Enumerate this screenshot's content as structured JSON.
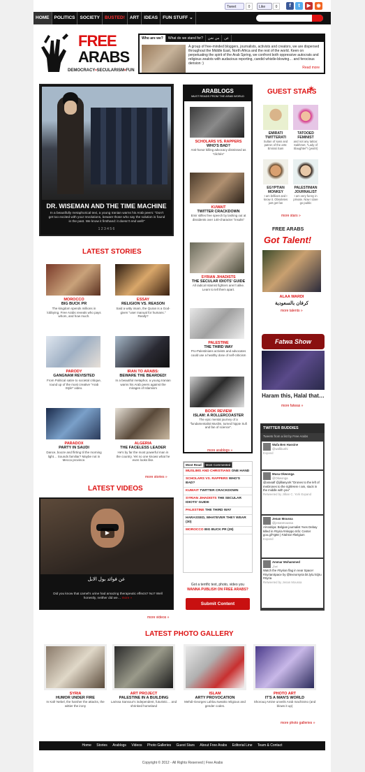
{
  "social": {
    "tweet": "Tweet",
    "like": "Like",
    "tweet_count": "0",
    "like_count": "0"
  },
  "nav": [
    "HOME",
    "POLITICS",
    "SOCIETY",
    "BUSTED!",
    "ART",
    "IDEAS",
    "FUN STUFF"
  ],
  "logo": {
    "line1": "FREE",
    "line2": "ARABS",
    "tag": [
      "DEMOCRACY",
      "SECULARISM",
      "FUN"
    ]
  },
  "who": {
    "tabs": [
      "Who are we?",
      "What do we stand for?",
      "من نحن",
      "عن"
    ],
    "text": "A group of free-minded bloggers, journalists, activists and creators, we are dispersed throughout the Middle East, North Africa and the rest of the world. Keen on perpetuating the spirit of the Arab Spring, we confront both oppressive autocrats and religious zealots with audacious reporting, candid whistle-blowing… and ferocious derision :)",
    "more": "Read more"
  },
  "hero": {
    "title": "DR. WISEMAN AND THE TIME MACHINE",
    "text": "In a beautifully metaphorical text, a young Iranian warns his Arab peers: \"Don't get too excited with your revolutions, beware those who say the solution is found in the past. We know it firsthand: it doesn't end well!\"",
    "pages": "1 2 3 4 5 6"
  },
  "latest": {
    "heading": "LATEST STORIES",
    "more": "more stories »",
    "items": [
      {
        "cat": "MOROCCO",
        "title": "BIG BUCK PR",
        "desc": "The kingdom spends millions in lobbying. Free Arabs reveals who pays whom, and how much."
      },
      {
        "cat": "ESSAY",
        "title": "RELIGION VS. REASON",
        "desc": "Said a witty imam, the Quran is a God-given \"user manual for humans.\" Really?"
      },
      {
        "cat": "PARODY",
        "title": "GANGNAM REVISITED",
        "desc": "From Political satire to societal critique, round up of the most creative \"Arab Style\" video."
      },
      {
        "cat": "IRAN TO ARABS:",
        "title": "BEWARE THE BEARDED!",
        "desc": "In a beautiful metaphor, a young Iranian warns his Arab peers against the mirages of Islamism"
      },
      {
        "cat": "PARADOX",
        "title": "PARTY IN SAUDI",
        "desc": "Dance, booze and flirting til the morning light… Sounds familiar? Maybe not in Mecca province."
      },
      {
        "cat": "ALGERIA",
        "title": "THE FACELESS LEADER",
        "desc": "He's by far the most powerful man in the country. Yet no one knows what he even looks like."
      }
    ]
  },
  "arablogs": {
    "title": "ARABLOGS",
    "sub": "MUST READS FROM THE ARAB WORLD",
    "more": "more arablogs »",
    "items": [
      {
        "t1": "SCHOLARS VS. RAPPERS",
        "t2": "WHO'S BAD?",
        "desc": "Anti-honor killing advocacy dismissed as \"clichés\""
      },
      {
        "t1": "KUWAIT",
        "t2": "TWITTER CRACKDOWN",
        "desc": "Emir stifles free speech by lashing out at dissidents over 140-character \"insults\""
      },
      {
        "t1": "SYRIAN JIHADISTS",
        "t2": "THE SECULAR IDIOTS' GUIDE",
        "desc": "All radical Islamist fighters aren't alike. Learn to tell them apart."
      },
      {
        "t1": "PALESTINE",
        "t2": "THE THIRD WAY",
        "desc": "Pro-Palestinians activists and advocates could use a healthy dose of self-criticism"
      },
      {
        "t1": "BOOK REVIEW",
        "t2": "ISLAM: A ROLLERCOASTER",
        "desc": "The epic mental journey of a \"fundamentalist Muslim, turned hippie Sufi and fan of science\"."
      }
    ]
  },
  "guests": {
    "title": "GUEST STARS",
    "more": "more stars »",
    "items": [
      {
        "name": "EMIRATI TWITTERATI",
        "desc": "Sultan of sass and patron of the arts: Emirati Sam"
      },
      {
        "name": "TATOOED FEMINIST",
        "desc": "and not any tattoo: Sakhmet, \"Lady of Slaughter\"! (yeah!)"
      },
      {
        "name": "EGYPTIAN MONKEY",
        "desc": "I am brilliant and I know it. Obsoletes just get fan"
      },
      {
        "name": "PALESTINIAN JOURNALIST",
        "desc": "I am very funny in private. Now I dare go public"
      }
    ]
  },
  "talent": {
    "title1": "FREE ARABS",
    "title2": "Got Talent!",
    "name": "ALAA WARDI",
    "arabic": "كرفان بالسعودية",
    "more": "more talents »"
  },
  "fatwa": {
    "title": "Fatwa Show",
    "caption": "Haram this, Halal that…",
    "more": "more fatwas »"
  },
  "videos": {
    "heading": "LATEST VIDEOS",
    "arabic": "عن فوائد بول الابل",
    "text": "Did you know that camel's urine had amazing therapeutic effects? No? Well honestly, neither did we…",
    "more_inline": "more »",
    "more": "more videos »"
  },
  "mostread": {
    "tabs": [
      "Most Read",
      "Most Commented"
    ],
    "items": [
      {
        "b": "MUSLIMS AND CHRISTIANS",
        "t": "ONE HAND"
      },
      {
        "b": "SCHOLARS VS. RAPPERS",
        "t": "WHO'S BAD?"
      },
      {
        "b": "KUWAIT",
        "t": "TWITTER CRACKDOWN"
      },
      {
        "b": "SYRIAN JIHADISTS",
        "t": "THE SECULAR IDIOTS' GUIDE"
      },
      {
        "b": "PALESTINE",
        "t": "THE THIRD WAY"
      },
      {
        "b": "",
        "t": "HARASSED, WHATEVER THEY WEAR (30)"
      },
      {
        "b": "MOROCCO",
        "t": "BIG BUCK PR (29)"
      }
    ]
  },
  "submit": {
    "q": "Got a terrific text, photo, video you",
    "link": "WANNA PUBLISH ON FREE ARABS?",
    "btn": "Submit Content"
  },
  "twitter": {
    "title": "TWITTER BUDDIES",
    "sub": "Tweets from a list by Free Arabs",
    "tweets": [
      {
        "user": "Wafa Ben Hassine",
        "handle": "@wafibunhi",
        "body": "",
        "ex": "Expand"
      },
      {
        "user": "Musa Okwonga",
        "handle": "@Okwonga",
        "body": "@arasalf @jillianyork \"Drones to the left of meDrones to the rightHere I am, stuck in the middle with you\"",
        "ex": "Retweeted by Jillian C. York   Expand"
      },
      {
        "user": "Jenan Moussa",
        "handle": "@jenanmoussa",
        "body": "AlArabiya: Belgian journalist Yves Debay killed in #Syria #Aleppo Info: Center goo.gl/Yg8e | #Jahrar #belgium",
        "ex": "Expand"
      },
      {
        "user": "Ammar Mohammed",
        "handle": "عمار",
        "body": "Watch the #Syrian flag in near Space! #SyrianSpace by @lexnorsyria bit.ly/LrSQIu #Syria",
        "ex": "Retweeted by Jenan Moussa"
      }
    ]
  },
  "gallery": {
    "heading": "LATEST PHOTO GALLERY",
    "more": "more photo galleries »",
    "items": [
      {
        "cat": "SYRIA",
        "title": "HUMOR UNDER FIRE",
        "desc": "In Kafr Nebel, the harsher the attacks, the wittier the irony"
      },
      {
        "cat": "ART PROJECT",
        "title": "PALESTINE IN A BUILDING",
        "desc": "Larissa Sansour's independent, futuristic… and shrinked homeland"
      },
      {
        "cat": "ISLAM",
        "title": "ARTY PROVOCATION",
        "desc": "Mehdi-Georges Lahlou tweaks religious and gender codes."
      },
      {
        "cat": "PHOTO ART",
        "title": "IT'S A MAN'S WORLD",
        "desc": "Shorouq Amine unveils Arab machismo (and blows it up)"
      }
    ]
  },
  "footer": {
    "links": [
      "Home",
      "Stories",
      "Arablogs",
      "Videos",
      "Photo Galleries",
      "Guest Stars",
      "About Free Arabs",
      "Editorial Line",
      "Team & Contact"
    ],
    "copyright": "Copyright © 2012 - All Rights Reserved | Free Arabs"
  },
  "colors": {
    "brand_red": "#d11111",
    "dark": "#111111"
  }
}
